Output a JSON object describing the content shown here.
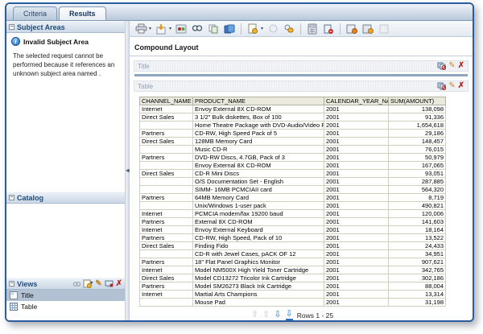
{
  "tabs": [
    {
      "label": "Criteria"
    },
    {
      "label": "Results"
    }
  ],
  "sidebar": {
    "subject_areas": {
      "title": "Subject Areas",
      "warning_title": "Invalid Subject Area",
      "warning_body": "The selected request cannot be performed because it references an unknown subject area named ."
    },
    "catalog": {
      "title": "Catalog"
    },
    "views": {
      "title": "Views",
      "toolbar_icons": [
        "preview-icon",
        "new-view-icon",
        "edit-view-icon",
        "add-to-layout-icon",
        "delete-view-icon"
      ],
      "items": [
        {
          "label": "Title",
          "icon": "title-view-icon",
          "selected": true
        },
        {
          "label": "Table",
          "icon": "table-view-icon",
          "selected": false
        }
      ]
    }
  },
  "main": {
    "toolbar_icons": [
      "print-icon",
      "download-icon",
      "refresh-icon",
      "search-icon",
      "copy-icon",
      "archive-icon",
      "new-view-icon",
      "preview-icon",
      "permissions-icon",
      "calculator-icon",
      "marker-icon",
      "chart-icon",
      "pivot-icon",
      "disabled-view-icon"
    ],
    "compound_layout_label": "Compound Layout",
    "sections": [
      {
        "label": "Title"
      },
      {
        "label": "Table"
      }
    ],
    "section_action_icons": [
      "remove-from-layout-icon",
      "edit-view-icon",
      "delete-view-icon"
    ],
    "pager_label": "Rows 1 - 25"
  },
  "table": {
    "headers": [
      "CHANNEL_NAME",
      "PRODUCT_NAME",
      "CALENDAR_YEAR_NAME",
      "SUM(AMOUNT)"
    ],
    "rows": [
      [
        "Internet",
        "Envoy External 8X CD-ROM",
        "2001",
        "138,098"
      ],
      [
        "Direct Sales",
        "3 1/2\" Bulk diskettes, Box of 100",
        "2001",
        "91,336"
      ],
      [
        "",
        "Home Theatre Package with DVD-Audio/Video Play",
        "2001",
        "1,654,618"
      ],
      [
        "Partners",
        "CD-RW, High Speed Pack of 5",
        "2001",
        "29,186"
      ],
      [
        "Direct Sales",
        "128MB Memory Card",
        "2001",
        "148,457"
      ],
      [
        "",
        "Music CD-R",
        "2001",
        "76,015"
      ],
      [
        "Partners",
        "DVD-RW Discs, 4.7GB, Pack of 3",
        "2001",
        "50,979"
      ],
      [
        "",
        "Envoy External 8X CD-ROM",
        "2001",
        "167,065"
      ],
      [
        "Direct Sales",
        "CD-R Mini Discs",
        "2001",
        "93,051"
      ],
      [
        "",
        "O/S Documentation Set - English",
        "2001",
        "287,885"
      ],
      [
        "",
        "SIMM- 16MB PCMCIAII card",
        "2001",
        "564,320"
      ],
      [
        "Partners",
        "64MB Memory Card",
        "2001",
        "8,719"
      ],
      [
        "",
        "Unix/Windows 1-user pack",
        "2001",
        "490,821"
      ],
      [
        "Internet",
        "PCMCIA modem/fax 19200 baud",
        "2001",
        "120,006"
      ],
      [
        "Partners",
        "External 8X CD-ROM",
        "2001",
        "141,603"
      ],
      [
        "Internet",
        "Envoy External Keyboard",
        "2001",
        "18,164"
      ],
      [
        "Partners",
        "CD-RW, High Speed, Pack of 10",
        "2001",
        "13,522"
      ],
      [
        "Direct Sales",
        "Finding Fido",
        "2001",
        "24,433"
      ],
      [
        "",
        "CD-R with Jewel Cases, pACK OF 12",
        "2001",
        "34,951"
      ],
      [
        "Partners",
        "18\" Flat Panel Graphics Monitor",
        "2001",
        "907,621"
      ],
      [
        "Internet",
        "Model NM500X High Yield Toner Cartridge",
        "2001",
        "342,765"
      ],
      [
        "Direct Sales",
        "Model CD13272 Tricolor Ink Cartridge",
        "2001",
        "302,186"
      ],
      [
        "Partners",
        "Model SM26273 Black Ink Cartridge",
        "2001",
        "88,004"
      ],
      [
        "Internet",
        "Martial Arts Champions",
        "2001",
        "13,314"
      ],
      [
        "",
        "Mouse Pad",
        "2001",
        "31,198"
      ]
    ]
  }
}
